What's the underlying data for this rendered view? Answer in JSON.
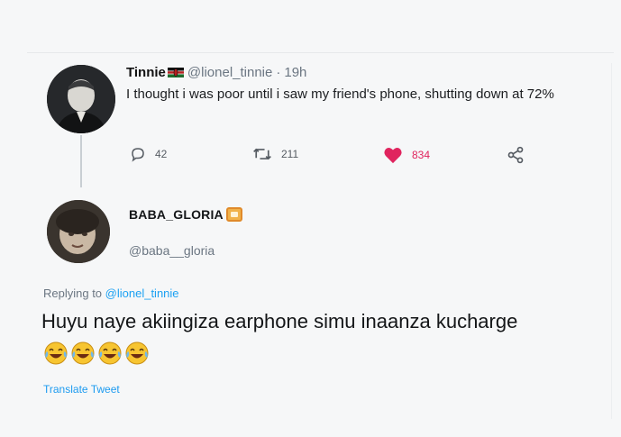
{
  "colors": {
    "accent": "#1d9bf0",
    "like": "#e0245e",
    "muted": "#6b7682"
  },
  "original_tweet": {
    "name": "Tinnie",
    "handle": "@lionel_tinnie",
    "separator": "·",
    "time": "19h",
    "text": "I thought i was poor until i saw my friend's phone, shutting down at 72%",
    "flag_icon": "kenya-flag-icon",
    "stats": {
      "replies": "42",
      "retweets": "211",
      "likes": "834"
    },
    "icons": {
      "reply": "reply-icon",
      "retweet": "retweet-icon",
      "like": "heart-icon",
      "share": "share-icon"
    }
  },
  "reply_tweet": {
    "name": "BABA_GLORIA",
    "badge_icon": "badge-icon",
    "handle": "@baba__gloria",
    "replying_prefix": "Replying to ",
    "replying_to": "@lionel_tinnie",
    "text": "Huyu naye akiingiza earphone simu inaanza kucharge",
    "emoji": [
      "face-with-tears-of-joy",
      "face-with-tears-of-joy",
      "face-with-tears-of-joy",
      "face-with-tears-of-joy"
    ],
    "translate_label": "Translate Tweet"
  }
}
